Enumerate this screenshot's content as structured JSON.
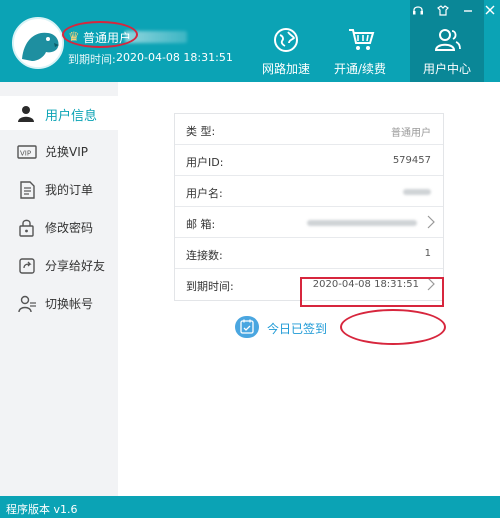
{
  "header": {
    "user_type": "普通用户",
    "expire_label": "到期时间:",
    "expire_value": "2020-04-08 18:31:51",
    "nav": [
      {
        "label": "网路加速",
        "icon": "globe-icon"
      },
      {
        "label": "开通/续费",
        "icon": "cart-icon"
      },
      {
        "label": "用户中心",
        "icon": "users-icon"
      }
    ],
    "window_controls": [
      "headset-icon",
      "skin-icon",
      "minimize-icon",
      "close-icon"
    ]
  },
  "sidebar": {
    "items": [
      {
        "label": "用户信息",
        "icon": "user-icon",
        "active": true
      },
      {
        "label": "兑换VIP",
        "icon": "vip-icon",
        "active": false
      },
      {
        "label": "我的订单",
        "icon": "order-icon",
        "active": false
      },
      {
        "label": "修改密码",
        "icon": "lock-icon",
        "active": false
      },
      {
        "label": "分享给好友",
        "icon": "share-icon",
        "active": false
      },
      {
        "label": "切换帐号",
        "icon": "switch-user-icon",
        "active": false
      }
    ]
  },
  "info": {
    "rows": [
      {
        "label": "类 型:",
        "value": "普通用户"
      },
      {
        "label": "用户ID:",
        "value": "579457"
      },
      {
        "label": "用户名:",
        "value": ""
      },
      {
        "label": "邮 箱:",
        "value": ""
      },
      {
        "label": "连接数:",
        "value": "1"
      },
      {
        "label": "到期时间:",
        "value": "2020-04-08 18:31:51"
      }
    ]
  },
  "checkin": {
    "label": "今日已签到"
  },
  "footer": {
    "version": "程序版本 v1.6"
  },
  "colors": {
    "brand": "#0ba3b5",
    "brand_dark": "#0a8797",
    "annotation": "#d7263d",
    "link": "#1e9ad6"
  }
}
